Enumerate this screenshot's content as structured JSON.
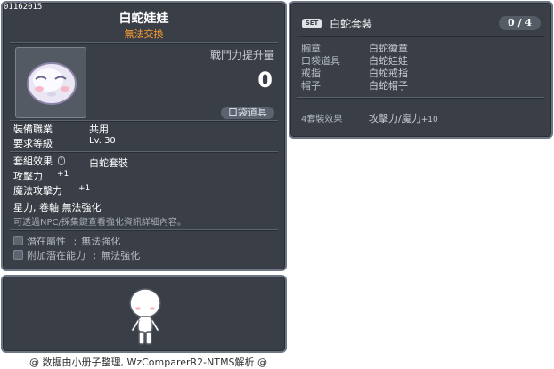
{
  "item_id": "01162015",
  "item_name": "白蛇娃娃",
  "trade_status": "無法交換",
  "power_label": "戰鬥力提升量",
  "power_value": "0",
  "category_badge": "口袋道具",
  "requirements": {
    "job_label": "裝備職業",
    "job_value": "共用",
    "level_label": "要求等級",
    "level_value": "Lv. 30"
  },
  "set_effect": {
    "label": "套組效果",
    "value": "白蛇套裝"
  },
  "stats": [
    {
      "label": "攻擊力",
      "value": "+1"
    },
    {
      "label": "魔法攻擊力",
      "value": "+1"
    }
  ],
  "enhance_line": "星力, 卷軸  無法強化",
  "enhance_note": "可透過NPC/採集鍵查看強化資訊詳細內容。",
  "potential": [
    {
      "label": "潛在屬性",
      "sep": ":",
      "value": "無法強化"
    },
    {
      "label": "附加潛在能力",
      "sep": ":",
      "value": "無法強化"
    }
  ],
  "set_panel": {
    "badge": "SET",
    "title": "白蛇套裝",
    "count": "0 / 4",
    "pieces": [
      {
        "slot": "胸章",
        "name": "白蛇徽章"
      },
      {
        "slot": "口袋道具",
        "name": "白蛇娃娃"
      },
      {
        "slot": "戒指",
        "name": "白蛇戒指"
      },
      {
        "slot": "帽子",
        "name": "白蛇帽子"
      }
    ],
    "bonus_label": "4套裝效果",
    "bonus_value": "攻擊力/魔力",
    "bonus_amount": "+10"
  },
  "footer": "@ 数据由小册子整理, WzComparerR2-NTMS解析 @",
  "colors": {
    "panel_bg": "#3a3f47",
    "panel_border": "#6c7684",
    "trade_status": "#ff9d2c"
  }
}
